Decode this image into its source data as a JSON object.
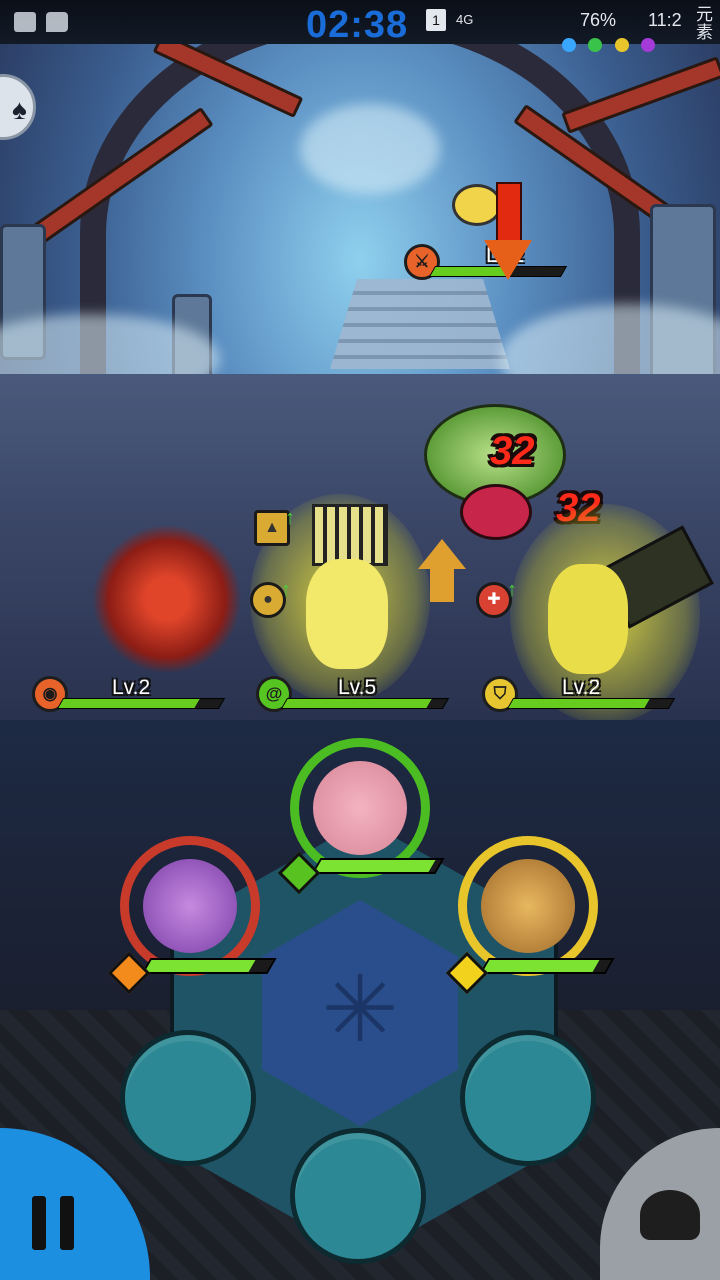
{
  "status_bar": {
    "clock_overlay": "02:38",
    "sim": "1",
    "network": "4G",
    "battery": "76%",
    "time": "11:2",
    "carrier_text": "元素"
  },
  "enemy": {
    "level": "Lv.2",
    "hp_fraction": 0.6,
    "badge_icon": "sword-icon"
  },
  "damage_numbers": [
    "32",
    "32"
  ],
  "heroes": [
    {
      "level": "Lv.2",
      "hp_fraction": 0.85,
      "badge_icon": "eye-icon",
      "badge_color": "#e8632a"
    },
    {
      "level": "Lv.5",
      "hp_fraction": 0.9,
      "badge_icon": "swirl-icon",
      "badge_color": "#56c421"
    },
    {
      "level": "Lv.2",
      "hp_fraction": 0.85,
      "badge_icon": "shield-icon",
      "badge_color": "#e6c531"
    }
  ],
  "portraits": [
    {
      "name": "moth-fairy",
      "ring_color": "#c83a2a",
      "hp_fraction": 0.85,
      "element_color": "#f28a1c"
    },
    {
      "name": "pig-warrior",
      "ring_color": "#4bbd22",
      "hp_fraction": 0.95,
      "element_color": "#58c320"
    },
    {
      "name": "bear-hero",
      "ring_color": "#e8c62b",
      "hp_fraction": 0.9,
      "element_color": "#f2d21d"
    }
  ],
  "colors": {
    "hp_green": "#66cc1d",
    "damage_red": "#ff2a1a",
    "pause_blue": "#1d8fe0",
    "slot_teal": "#2b8894"
  }
}
